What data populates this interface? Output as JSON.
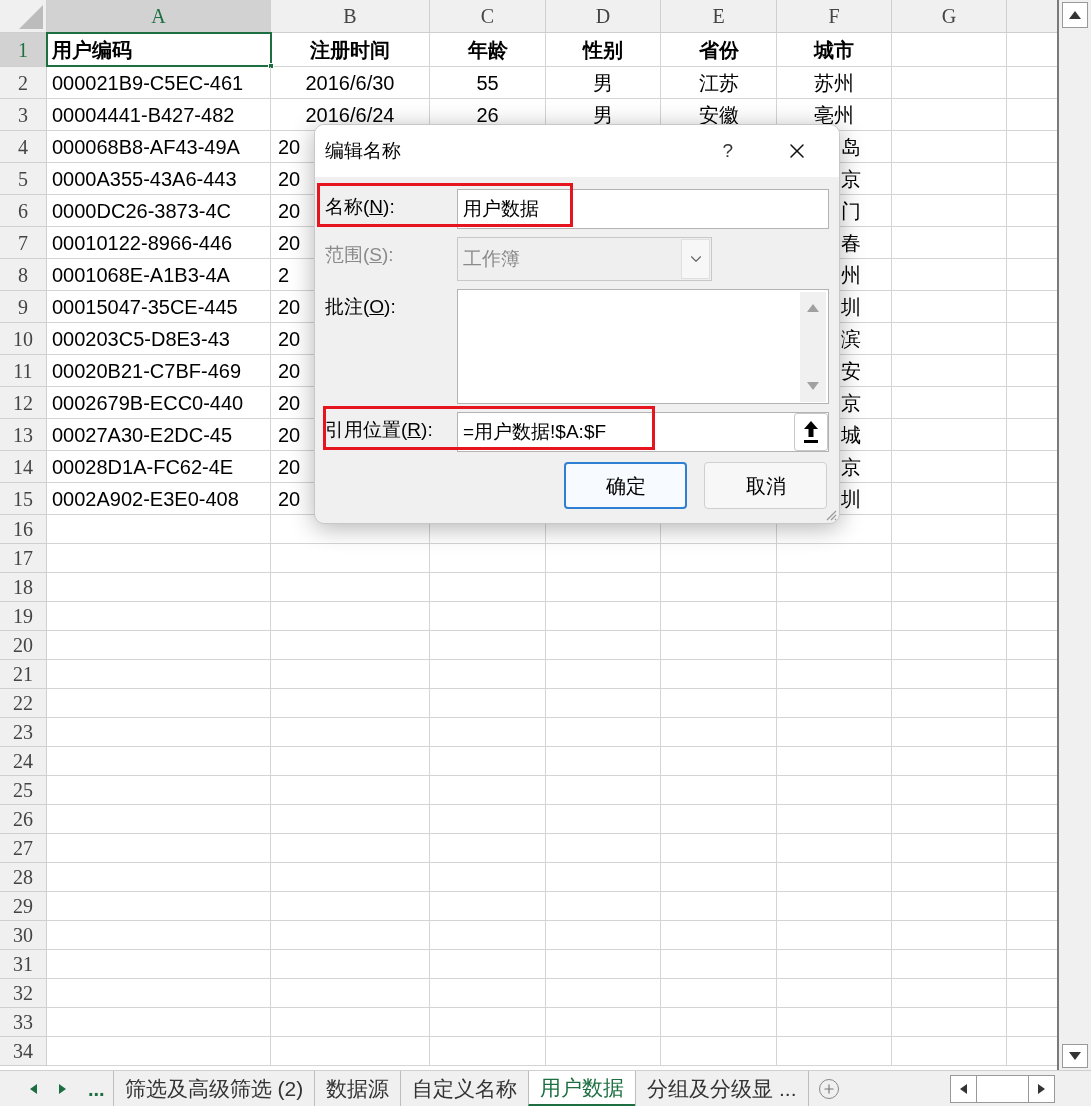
{
  "columns": [
    {
      "label": "A",
      "selected": true
    },
    {
      "label": "B",
      "selected": false
    },
    {
      "label": "C",
      "selected": false
    },
    {
      "label": "D",
      "selected": false
    },
    {
      "label": "E",
      "selected": false
    },
    {
      "label": "F",
      "selected": false
    },
    {
      "label": "G",
      "selected": false
    }
  ],
  "rows": [
    {
      "num": "1",
      "kind": "header",
      "selected": true,
      "covered": false,
      "a": "用户编码",
      "b": "注册时间",
      "c": "年龄",
      "d": "性别",
      "e": "省份",
      "f": "城市"
    },
    {
      "num": "2",
      "kind": "data",
      "selected": false,
      "covered": false,
      "a": "000021B9-C5EC-461",
      "b": "2016/6/30",
      "c": "55",
      "d": "男",
      "e": "江苏",
      "f": "苏州"
    },
    {
      "num": "3",
      "kind": "data",
      "selected": false,
      "covered": false,
      "a": "00004441-B427-482",
      "b": "2016/6/24",
      "c": "26",
      "d": "男",
      "e": "安徽",
      "f": "亳州"
    },
    {
      "num": "4",
      "kind": "data",
      "selected": false,
      "covered": true,
      "a": "000068B8-AF43-49A",
      "b": "20",
      "f": "岛"
    },
    {
      "num": "5",
      "kind": "data",
      "selected": false,
      "covered": true,
      "a": "0000A355-43A6-443",
      "b": "20",
      "f": "京"
    },
    {
      "num": "6",
      "kind": "data",
      "selected": false,
      "covered": true,
      "a": "0000DC26-3873-4C",
      "b": "20",
      "f": "门"
    },
    {
      "num": "7",
      "kind": "data",
      "selected": false,
      "covered": true,
      "a": "00010122-8966-446",
      "b": "20",
      "f": "春"
    },
    {
      "num": "8",
      "kind": "data",
      "selected": false,
      "covered": true,
      "a": "0001068E-A1B3-4A",
      "b": "2",
      "f": "州"
    },
    {
      "num": "9",
      "kind": "data",
      "selected": false,
      "covered": true,
      "a": "00015047-35CE-445",
      "b": "20",
      "f": "圳"
    },
    {
      "num": "10",
      "kind": "data",
      "selected": false,
      "covered": true,
      "a": "000203C5-D8E3-43",
      "b": "20",
      "f": "滨"
    },
    {
      "num": "11",
      "kind": "data",
      "selected": false,
      "covered": true,
      "a": "00020B21-C7BF-469",
      "b": "20",
      "f": "安"
    },
    {
      "num": "12",
      "kind": "data",
      "selected": false,
      "covered": true,
      "a": "0002679B-ECC0-440",
      "b": "20",
      "f": "京"
    },
    {
      "num": "13",
      "kind": "data",
      "selected": false,
      "covered": true,
      "a": "00027A30-E2DC-45",
      "b": "20",
      "f": "城"
    },
    {
      "num": "14",
      "kind": "data",
      "selected": false,
      "covered": true,
      "a": "00028D1A-FC62-4E",
      "b": "20",
      "f": "京"
    },
    {
      "num": "15",
      "kind": "data",
      "selected": false,
      "covered": true,
      "a": "0002A902-E3E0-408",
      "b": "20",
      "f": "圳"
    }
  ],
  "empty_rows": [
    "16",
    "17",
    "18",
    "19",
    "20",
    "21",
    "22",
    "23",
    "24",
    "25",
    "26",
    "27",
    "28",
    "29",
    "30",
    "31",
    "32",
    "33",
    "34"
  ],
  "dialog": {
    "title": "编辑名称",
    "help": "?",
    "fields": [
      {
        "kind": "text",
        "label_before": "名称(",
        "accesskey": "N",
        "label_after": "):",
        "value": "用户数据",
        "disabled": false,
        "highlighted": true
      },
      {
        "kind": "select",
        "label_before": "范围(",
        "accesskey": "S",
        "label_after": "):",
        "value": "工作簿",
        "disabled": true,
        "highlighted": false
      },
      {
        "kind": "textarea",
        "label_before": "批注(",
        "accesskey": "O",
        "label_after": "):",
        "disabled": false,
        "highlighted": false
      },
      {
        "kind": "reference",
        "label_before": "引用位置(",
        "accesskey": "R",
        "label_after": "):",
        "value": "=用户数据!$A:$F",
        "disabled": false,
        "highlighted": true
      }
    ],
    "buttons": [
      {
        "label": "确定",
        "default": true
      },
      {
        "label": "取消",
        "default": false
      }
    ]
  },
  "sheet_tabs": {
    "more": "...",
    "tabs": [
      {
        "label": "筛选及高级筛选 (2)",
        "selected": false
      },
      {
        "label": "数据源",
        "selected": false
      },
      {
        "label": "自定义名称",
        "selected": false
      },
      {
        "label": "用户数据",
        "selected": true
      },
      {
        "label": "分组及分级显 ...",
        "selected": false
      }
    ]
  }
}
